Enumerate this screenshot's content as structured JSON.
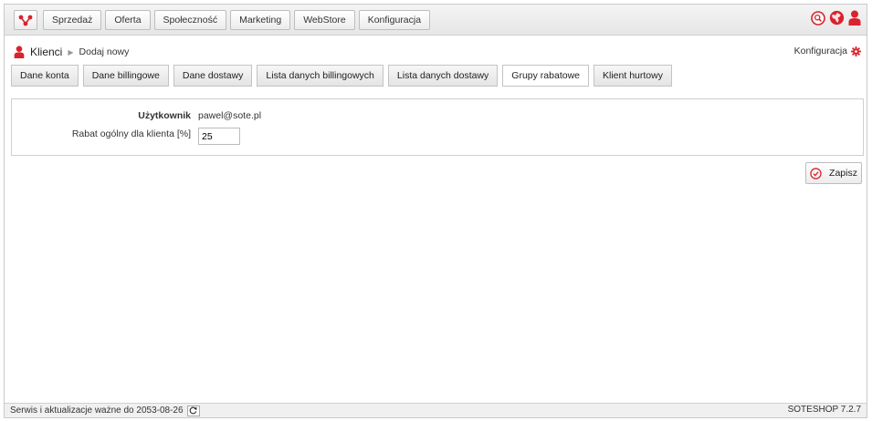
{
  "nav": {
    "logo_icon": "soteshop-logo-icon",
    "items": [
      "Sprzedaż",
      "Oferta",
      "Społeczność",
      "Marketing",
      "WebStore",
      "Konfiguracja"
    ]
  },
  "top_icons": [
    "search-icon",
    "globe-icon",
    "user-icon"
  ],
  "breadcrumb": {
    "root": "Klienci",
    "current": "Dodaj nowy"
  },
  "config_link": {
    "label": "Konfiguracja"
  },
  "tabs": {
    "items": [
      "Dane konta",
      "Dane billingowe",
      "Dane dostawy",
      "Lista danych billingowych",
      "Lista danych dostawy",
      "Grupy rabatowe",
      "Klient hurtowy"
    ],
    "active": "Grupy rabatowe"
  },
  "form": {
    "user_label": "Użytkownik",
    "user_value": "pawel@sote.pl",
    "discount_label": "Rabat ogólny dla klienta [%]",
    "discount_value": "25"
  },
  "save": {
    "label": "Zapisz"
  },
  "status": {
    "text": "Serwis i aktualizacje ważne do 2053-08-26",
    "version": "SOTESHOP 7.2.7"
  },
  "colors": {
    "accent": "#d9232d"
  }
}
